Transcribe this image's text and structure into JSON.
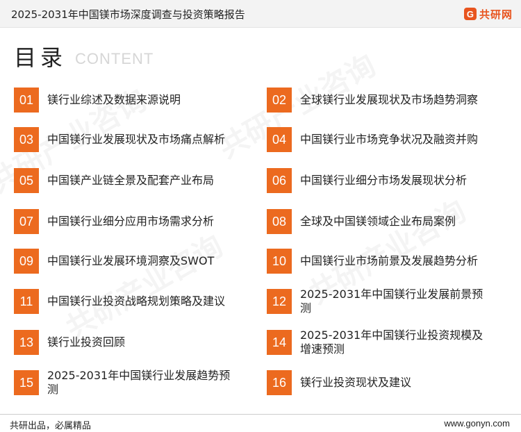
{
  "header": {
    "title": "2025-2031年中国镁市场深度调查与投资策略报告",
    "logo_mark": "G",
    "logo_text": "共研网",
    "accent_color": "#e8541e"
  },
  "toc": {
    "title": "目录",
    "subtitle": "CONTENT",
    "number_bg_color": "#ec6a1f",
    "items": [
      {
        "num": "01",
        "label": "镁行业综述及数据来源说明"
      },
      {
        "num": "02",
        "label": "全球镁行业发展现状及市场趋势洞察"
      },
      {
        "num": "03",
        "label": "中国镁行业发展现状及市场痛点解析"
      },
      {
        "num": "04",
        "label": "中国镁行业市场竞争状况及融资并购"
      },
      {
        "num": "05",
        "label": "中国镁产业链全景及配套产业布局"
      },
      {
        "num": "06",
        "label": "中国镁行业细分市场发展现状分析"
      },
      {
        "num": "07",
        "label": "中国镁行业细分应用市场需求分析"
      },
      {
        "num": "08",
        "label": "全球及中国镁领域企业布局案例"
      },
      {
        "num": "09",
        "label": "中国镁行业发展环境洞察及SWOT"
      },
      {
        "num": "10",
        "label": "中国镁行业市场前景及发展趋势分析"
      },
      {
        "num": "11",
        "label": "中国镁行业投资战略规划策略及建议"
      },
      {
        "num": "12",
        "label": "2025-2031年中国镁行业发展前景预测"
      },
      {
        "num": "13",
        "label": "镁行业投资回顾"
      },
      {
        "num": "14",
        "label": "2025-2031年中国镁行业投资规模及增速预测"
      },
      {
        "num": "15",
        "label": "2025-2031年中国镁行业发展趋势预测"
      },
      {
        "num": "16",
        "label": "镁行业投资现状及建议"
      }
    ]
  },
  "watermark": "共研产业咨询",
  "footer": {
    "slogan": "共研出品，必属精品",
    "url": "www.gonyn.com"
  }
}
